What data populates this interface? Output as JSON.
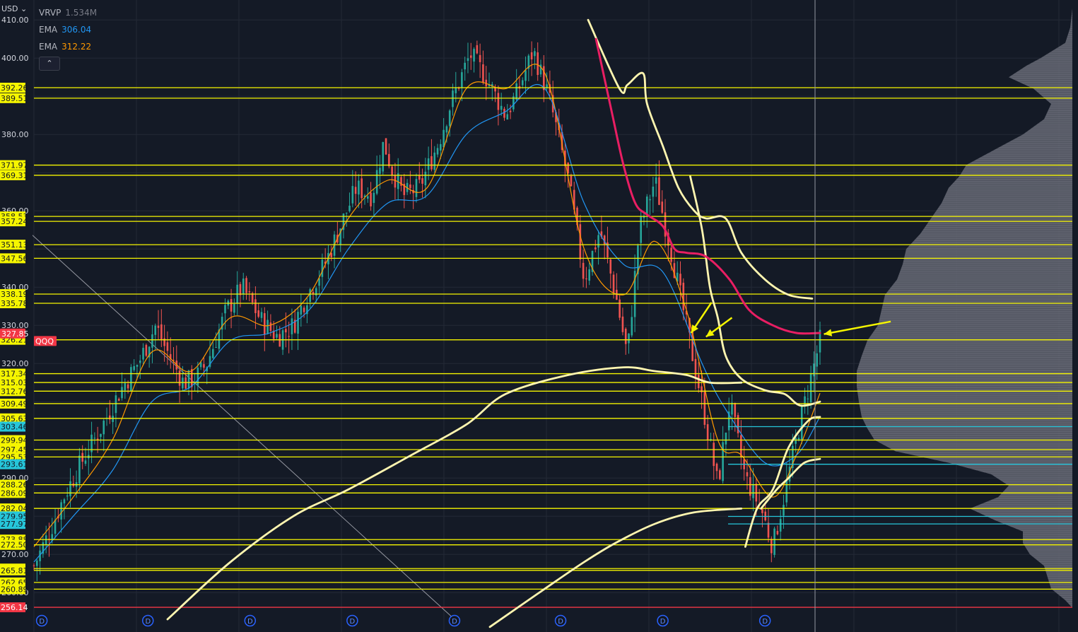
{
  "header": {
    "currency": "USD",
    "currency_caret": "⌄",
    "collapse_label": "⌃"
  },
  "legend": [
    {
      "name": "VRVP",
      "value": "1.534M",
      "color": "#787b86"
    },
    {
      "name": "EMA",
      "value": "306.04",
      "color": "#2196f3"
    },
    {
      "name": "EMA",
      "value": "312.22",
      "color": "#ff9800"
    }
  ],
  "colors": {
    "background": "#141a26",
    "grid": "#232936",
    "level": "#f5f500",
    "level_blue": "#26c6da",
    "support_red": "#f23645",
    "candle_up": "#26a69a",
    "candle_down": "#ef5350",
    "freehand": "#fff6b0",
    "freehand_red": "#e91e63",
    "arrow": "#f5f500",
    "volume_profile": "#6b6f7a"
  },
  "chart_data": {
    "type": "candlestick",
    "y_axis": {
      "ylim": [
        253,
        413
      ],
      "ticks": [
        "410.00",
        "400.00",
        "380.00",
        "360.00",
        "340.00",
        "330.00",
        "320.00",
        "290.00",
        "270.00",
        "260.00"
      ]
    },
    "horizontal_levels": [
      {
        "label": "392.26",
        "value": 392.26,
        "color": "yellow"
      },
      {
        "label": "389.51",
        "value": 389.51,
        "color": "yellow"
      },
      {
        "label": "371.97",
        "value": 371.97,
        "color": "yellow"
      },
      {
        "label": "369.31",
        "value": 369.31,
        "color": "yellow"
      },
      {
        "label": "358.53",
        "value": 358.53,
        "color": "yellow"
      },
      {
        "label": "357.24",
        "value": 357.24,
        "color": "yellow"
      },
      {
        "label": "351.13",
        "value": 351.13,
        "color": "yellow"
      },
      {
        "label": "347.56",
        "value": 347.56,
        "color": "yellow"
      },
      {
        "label": "338.19",
        "value": 338.19,
        "color": "yellow"
      },
      {
        "label": "335.78",
        "value": 335.78,
        "color": "yellow"
      },
      {
        "label": "326.21",
        "value": 326.21,
        "color": "yellow"
      },
      {
        "label": "317.34",
        "value": 317.34,
        "color": "yellow"
      },
      {
        "label": "315.03",
        "value": 315.03,
        "color": "yellow"
      },
      {
        "label": "312.76",
        "value": 312.76,
        "color": "yellow"
      },
      {
        "label": "309.49",
        "value": 309.49,
        "color": "yellow"
      },
      {
        "label": "305.63",
        "value": 305.63,
        "color": "yellow"
      },
      {
        "label": "303.46",
        "value": 303.46,
        "color": "blue"
      },
      {
        "label": "299.94",
        "value": 299.94,
        "color": "yellow"
      },
      {
        "label": "297.45",
        "value": 297.45,
        "color": "yellow"
      },
      {
        "label": "295.53",
        "value": 295.53,
        "color": "yellow"
      },
      {
        "label": "293.61",
        "value": 293.61,
        "color": "blue"
      },
      {
        "label": "288.26",
        "value": 288.26,
        "color": "yellow"
      },
      {
        "label": "286.09",
        "value": 286.09,
        "color": "yellow"
      },
      {
        "label": "282.04",
        "value": 282.04,
        "color": "yellow"
      },
      {
        "label": "279.95",
        "value": 279.95,
        "color": "blue"
      },
      {
        "label": "277.97",
        "value": 277.97,
        "color": "blue"
      },
      {
        "label": "273.88",
        "value": 273.88,
        "color": "yellow"
      },
      {
        "label": "272.50",
        "value": 272.5,
        "color": "yellow"
      },
      {
        "label": "266.29",
        "value": 266.29,
        "color": "yellow"
      },
      {
        "label": "265.81",
        "value": 265.81,
        "color": "yellow"
      },
      {
        "label": "262.65",
        "value": 262.65,
        "color": "yellow"
      },
      {
        "label": "260.89",
        "value": 260.89,
        "color": "yellow"
      },
      {
        "label": "256.14",
        "value": 256.14,
        "color": "red"
      }
    ],
    "price_tags": [
      {
        "label": "327.85",
        "value": 327.85,
        "color": "#f23645"
      },
      {
        "label": "QQQ",
        "value": 325.9,
        "color": "#f23645"
      }
    ],
    "close_path": [
      [
        0,
        267
      ],
      [
        0.02,
        276
      ],
      [
        0.04,
        286
      ],
      [
        0.06,
        294
      ],
      [
        0.085,
        303
      ],
      [
        0.11,
        313
      ],
      [
        0.135,
        321
      ],
      [
        0.155,
        330
      ],
      [
        0.165,
        325
      ],
      [
        0.19,
        315
      ],
      [
        0.205,
        316
      ],
      [
        0.22,
        320
      ],
      [
        0.245,
        334
      ],
      [
        0.265,
        340
      ],
      [
        0.29,
        331
      ],
      [
        0.31,
        327
      ],
      [
        0.33,
        330
      ],
      [
        0.345,
        337
      ],
      [
        0.37,
        346
      ],
      [
        0.39,
        356
      ],
      [
        0.41,
        366
      ],
      [
        0.43,
        364
      ],
      [
        0.445,
        378
      ],
      [
        0.455,
        371
      ],
      [
        0.47,
        364
      ],
      [
        0.49,
        366
      ],
      [
        0.515,
        378
      ],
      [
        0.53,
        388
      ],
      [
        0.555,
        401
      ],
      [
        0.575,
        395
      ],
      [
        0.6,
        385
      ],
      [
        0.615,
        391
      ],
      [
        0.635,
        402
      ],
      [
        0.655,
        390
      ],
      [
        0.68,
        368
      ],
      [
        0.7,
        342
      ],
      [
        0.72,
        355
      ],
      [
        0.74,
        338
      ],
      [
        0.755,
        322
      ],
      [
        0.77,
        355
      ],
      [
        0.79,
        368
      ],
      [
        0.81,
        350
      ],
      [
        0.83,
        330
      ],
      [
        0.85,
        310
      ],
      [
        0.87,
        288
      ],
      [
        0.885,
        310
      ],
      [
        0.905,
        290
      ],
      [
        0.925,
        282
      ],
      [
        0.94,
        272
      ],
      [
        0.955,
        286
      ],
      [
        0.975,
        305
      ],
      [
        1.0,
        326
      ]
    ],
    "ema_fast_path": [
      [
        0,
        272
      ],
      [
        0.05,
        285
      ],
      [
        0.1,
        300
      ],
      [
        0.15,
        323
      ],
      [
        0.2,
        318
      ],
      [
        0.25,
        332
      ],
      [
        0.3,
        330
      ],
      [
        0.35,
        338
      ],
      [
        0.4,
        358
      ],
      [
        0.45,
        368
      ],
      [
        0.5,
        366
      ],
      [
        0.55,
        392
      ],
      [
        0.6,
        392
      ],
      [
        0.65,
        396
      ],
      [
        0.7,
        350
      ],
      [
        0.75,
        338
      ],
      [
        0.79,
        352
      ],
      [
        0.83,
        334
      ],
      [
        0.87,
        300
      ],
      [
        0.9,
        296
      ],
      [
        0.94,
        285
      ],
      [
        0.97,
        296
      ],
      [
        1.0,
        312.22
      ]
    ],
    "ema_slow_path": [
      [
        0,
        268
      ],
      [
        0.05,
        280
      ],
      [
        0.1,
        292
      ],
      [
        0.15,
        310
      ],
      [
        0.2,
        314
      ],
      [
        0.25,
        326
      ],
      [
        0.3,
        328
      ],
      [
        0.35,
        334
      ],
      [
        0.4,
        350
      ],
      [
        0.45,
        362
      ],
      [
        0.5,
        364
      ],
      [
        0.55,
        380
      ],
      [
        0.6,
        386
      ],
      [
        0.65,
        392
      ],
      [
        0.7,
        362
      ],
      [
        0.75,
        346
      ],
      [
        0.8,
        344
      ],
      [
        0.85,
        320
      ],
      [
        0.88,
        308
      ],
      [
        0.93,
        294
      ],
      [
        0.97,
        296
      ],
      [
        1.0,
        306.04
      ]
    ],
    "volume_profile_path": [
      [
        413,
        0
      ],
      [
        408,
        3
      ],
      [
        404,
        10
      ],
      [
        400,
        45
      ],
      [
        398,
        65
      ],
      [
        395,
        90
      ],
      [
        392,
        55
      ],
      [
        388,
        30
      ],
      [
        384,
        40
      ],
      [
        380,
        70
      ],
      [
        376,
        110
      ],
      [
        372,
        150
      ],
      [
        369,
        160
      ],
      [
        366,
        175
      ],
      [
        362,
        185
      ],
      [
        358,
        200
      ],
      [
        354,
        215
      ],
      [
        350,
        235
      ],
      [
        346,
        240
      ],
      [
        342,
        248
      ],
      [
        338,
        265
      ],
      [
        334,
        270
      ],
      [
        330,
        275
      ],
      [
        326,
        290
      ],
      [
        322,
        298
      ],
      [
        318,
        305
      ],
      [
        314,
        305
      ],
      [
        310,
        302
      ],
      [
        306,
        298
      ],
      [
        303,
        290
      ],
      [
        300,
        280
      ],
      [
        297,
        250
      ],
      [
        294,
        175
      ],
      [
        291,
        115
      ],
      [
        288,
        90
      ],
      [
        285,
        105
      ],
      [
        282,
        145
      ],
      [
        279,
        110
      ],
      [
        276,
        70
      ],
      [
        273,
        70
      ],
      [
        270,
        60
      ],
      [
        267,
        40
      ],
      [
        264,
        35
      ],
      [
        261,
        30
      ],
      [
        258,
        10
      ],
      [
        256,
        0
      ]
    ],
    "freehand_paths": [
      {
        "color": "cream",
        "points": [
          [
            0.17,
            253
          ],
          [
            0.25,
            268
          ],
          [
            0.33,
            280
          ],
          [
            0.4,
            287
          ],
          [
            0.48,
            296
          ],
          [
            0.55,
            304
          ],
          [
            0.6,
            312
          ],
          [
            0.68,
            317
          ],
          [
            0.75,
            319
          ],
          [
            0.79,
            318
          ],
          [
            0.83,
            317
          ],
          [
            0.86,
            315
          ],
          [
            0.9,
            315
          ]
        ]
      },
      {
        "color": "cream",
        "points": [
          [
            0.58,
            251
          ],
          [
            0.65,
            261
          ],
          [
            0.7,
            268
          ],
          [
            0.74,
            273
          ],
          [
            0.79,
            278
          ],
          [
            0.84,
            281
          ],
          [
            0.9,
            282
          ]
        ]
      },
      {
        "color": "cream",
        "points": [
          [
            0.705,
            410
          ],
          [
            0.745,
            392
          ],
          [
            0.755,
            393
          ],
          [
            0.775,
            396
          ],
          [
            0.78,
            388
          ],
          [
            0.8,
            377
          ],
          [
            0.82,
            366
          ],
          [
            0.84,
            360
          ],
          [
            0.855,
            358
          ],
          [
            0.88,
            358
          ],
          [
            0.9,
            349
          ],
          [
            0.93,
            342
          ],
          [
            0.96,
            338
          ],
          [
            0.99,
            337
          ]
        ]
      },
      {
        "color": "cream",
        "points": [
          [
            0.835,
            369
          ],
          [
            0.85,
            355
          ],
          [
            0.86,
            340
          ],
          [
            0.87,
            332
          ],
          [
            0.88,
            322
          ],
          [
            0.9,
            316
          ],
          [
            0.93,
            313
          ],
          [
            0.955,
            312
          ],
          [
            0.975,
            309
          ],
          [
            1.0,
            310
          ]
        ]
      },
      {
        "color": "cream",
        "points": [
          [
            0.905,
            272
          ],
          [
            0.92,
            282
          ],
          [
            0.94,
            287
          ],
          [
            0.96,
            298
          ],
          [
            0.985,
            305
          ],
          [
            1.0,
            306
          ]
        ]
      },
      {
        "color": "cream",
        "points": [
          [
            0.925,
            282
          ],
          [
            0.945,
            287
          ],
          [
            0.96,
            290
          ],
          [
            0.98,
            294
          ],
          [
            1.0,
            295
          ]
        ]
      },
      {
        "color": "red",
        "points": [
          [
            0.715,
            405
          ],
          [
            0.735,
            386
          ],
          [
            0.75,
            372
          ],
          [
            0.765,
            362
          ],
          [
            0.78,
            359
          ],
          [
            0.8,
            356
          ],
          [
            0.815,
            350
          ],
          [
            0.83,
            349
          ],
          [
            0.855,
            348
          ],
          [
            0.885,
            342
          ],
          [
            0.91,
            334
          ],
          [
            0.94,
            330
          ],
          [
            0.97,
            328
          ],
          [
            1.0,
            328
          ]
        ]
      }
    ],
    "arrows": [
      {
        "from": [
          0.862,
          336
        ],
        "to": [
          0.836,
          328
        ]
      },
      {
        "from": [
          0.888,
          332
        ],
        "to": [
          0.855,
          327
        ]
      },
      {
        "from": [
          1.09,
          331
        ],
        "to": [
          1.005,
          327.7
        ]
      }
    ],
    "diagonal_trendline": {
      "from": [
        -0.02,
        357
      ],
      "to": [
        0.535,
        253
      ]
    },
    "dividend_markers": [
      0.01,
      0.145,
      0.275,
      0.405,
      0.535,
      0.67,
      0.8,
      0.93
    ]
  }
}
